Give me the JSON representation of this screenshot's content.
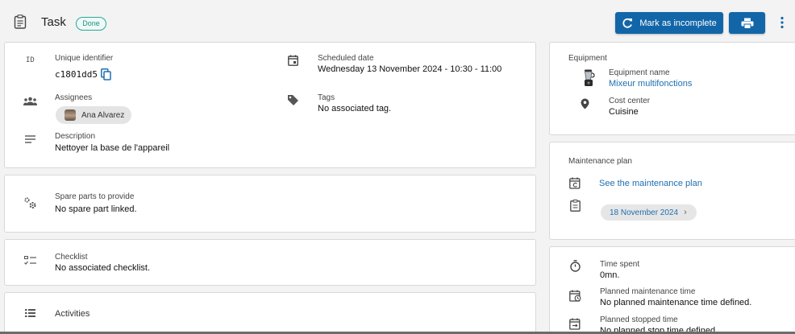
{
  "header": {
    "title": "Task",
    "status_badge": "Done",
    "mark_incomplete_label": "Mark as incomplete",
    "print_icon": "printer-icon",
    "more_icon": "kebab-icon"
  },
  "details": {
    "id_label": "Unique identifier",
    "id_icon_text": "ID",
    "id_value": "c1801dd5",
    "scheduled_label": "Scheduled date",
    "scheduled_value": "Wednesday 13 November 2024 - 10:30 - 11:00",
    "assignees_label": "Assignees",
    "assignee_name": "Ana Alvarez",
    "tags_label": "Tags",
    "tags_value": "No associated tag.",
    "description_label": "Description",
    "description_value": "Nettoyer la base de l'appareil"
  },
  "spare_parts": {
    "label": "Spare parts to provide",
    "value": "No spare part linked."
  },
  "checklist": {
    "label": "Checklist",
    "value": "No associated checklist."
  },
  "activities": {
    "label": "Activities"
  },
  "equipment": {
    "title": "Equipment",
    "name_label": "Equipment name",
    "name_value": "Mixeur multifonctions",
    "cost_label": "Cost center",
    "cost_value": "Cuisine"
  },
  "maintenance_plan": {
    "title": "Maintenance plan",
    "link": "See the maintenance plan",
    "date_chip": "18 November 2024"
  },
  "time": {
    "spent_label": "Time spent",
    "spent_value": "0mn.",
    "planned_label": "Planned maintenance time",
    "planned_value": "No planned maintenance time defined.",
    "stopped_label": "Planned stopped time",
    "stopped_value": "No planned stop time defined."
  },
  "colors": {
    "primary": "#1266a8",
    "link": "#1e6fb0",
    "done_badge": "#2aa79b"
  }
}
